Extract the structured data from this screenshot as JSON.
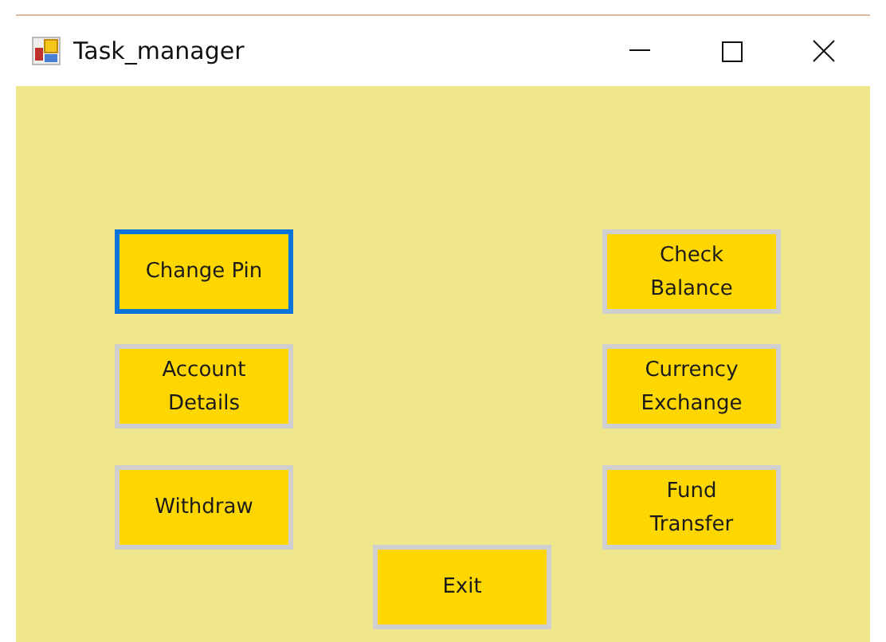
{
  "window": {
    "title": "Task_manager"
  },
  "left_buttons": [
    {
      "label": "Change Pin",
      "focused": true
    },
    {
      "label": "Account\nDetails",
      "focused": false
    },
    {
      "label": "Withdraw",
      "focused": false
    }
  ],
  "right_buttons": [
    {
      "label": "Check\nBalance",
      "focused": false
    },
    {
      "label": "Currency\nExchange",
      "focused": false
    },
    {
      "label": "Fund\nTransfer",
      "focused": false
    }
  ],
  "exit_button": {
    "label": "Exit",
    "focused": false
  }
}
